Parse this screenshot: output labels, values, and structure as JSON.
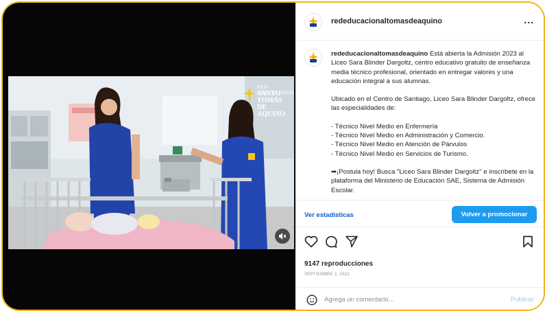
{
  "post": {
    "username": "rededucacionaltomasdeaquino",
    "more_label": "...",
    "caption_username": "rededucacionaltomasdeaquino",
    "caption_intro": "Está abierta la Admisión 2023 al Liceo Sara Blinder Dargoltz, centro educativo gratuito de enseñanza media técnico profesional, orientado en entregar valores y una educación integral a sus alumnas.",
    "caption_para2": "Ubicado en el Centro de Santiago, Liceo Sara Blinder Dargoltz, ofrece las especialidades de:",
    "specialties": [
      "- Técnico Nivel Medio en Enfermería",
      "- Técnico Nivel Medio en Administración y Comercio.",
      "- Técnico Nivel Medio en Atención de Párvulos",
      "- Técnico Nivel Medio en Servicios de Turismo."
    ],
    "caption_cta": "➡¡Postula hoy! Busca \"Liceo Sara Blinder Dargoltz\" e inscríbete en la plataforma del Ministerio de Educación SAE, Sistema de Admisión Escolar."
  },
  "video": {
    "overlay_small": "RED EDUCACIONAL",
    "overlay_big": "SANTO TOMÁS DE AQUINO"
  },
  "promo": {
    "stats_label": "Ver estadísticas",
    "button_label": "Volver a promocionar"
  },
  "meta": {
    "views": "9147 reproducciones",
    "date": "SEPTIEMBRE 2, 2022"
  },
  "comment": {
    "placeholder": "Agrega un comentario...",
    "publish_label": "Publicar"
  },
  "colors": {
    "frame": "#f2b21a",
    "accent": "#1d9bf0",
    "link": "#0a5bd0"
  }
}
